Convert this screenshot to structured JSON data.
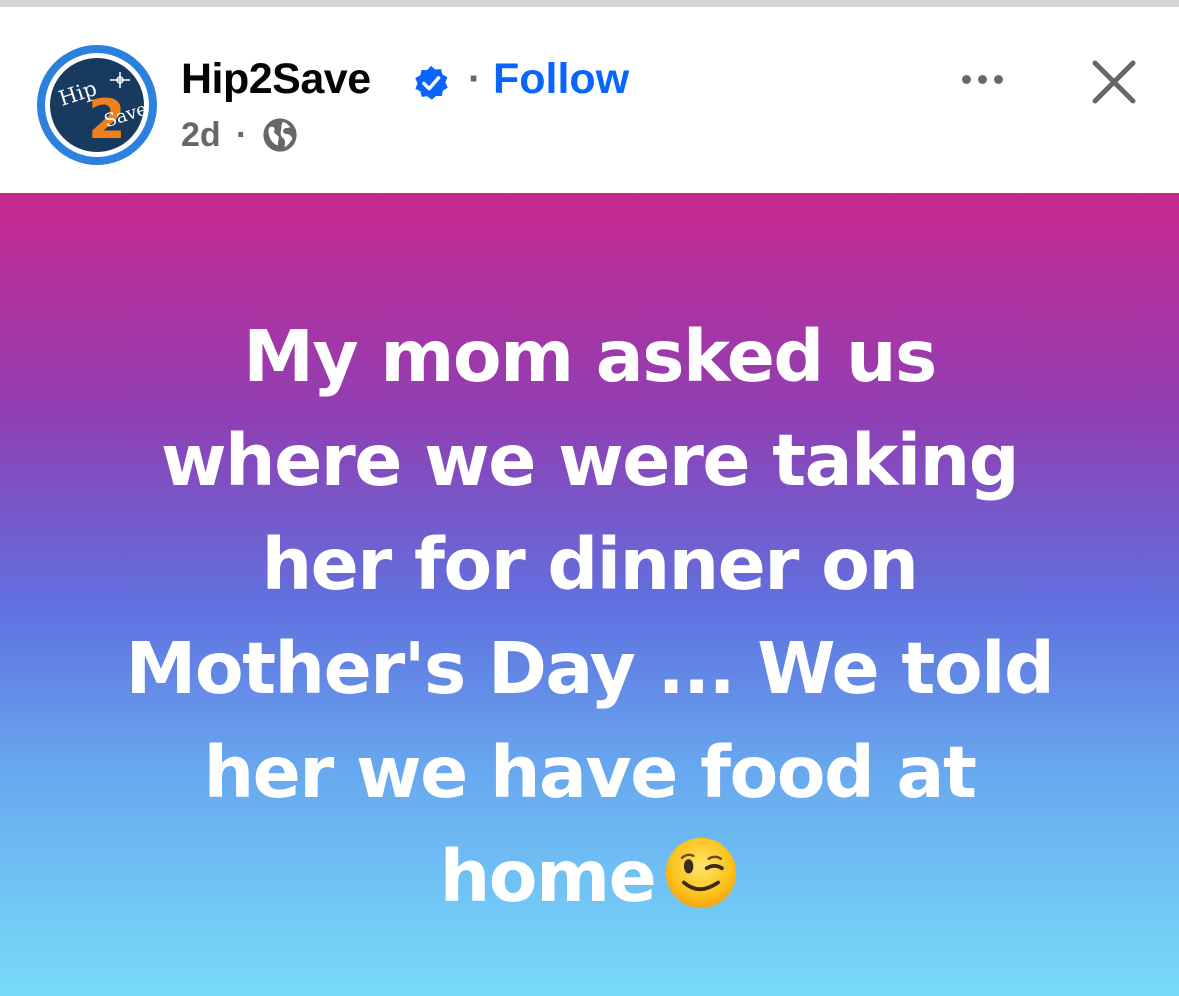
{
  "post": {
    "page_name": "Hip2Save",
    "follow_label": "Follow",
    "separator": "·",
    "timestamp": "2d",
    "privacy_icon": "globe-icon",
    "avatar_logo_text": "Hip 2 Save",
    "verified_icon": "verified-badge-icon",
    "more_icon": "more-options-icon",
    "close_icon": "close-icon",
    "text_lines": [
      "My mom asked us",
      "where we were taking",
      "her for dinner on",
      "Mother's Day ... We told",
      "her we have food at",
      "home"
    ],
    "emoji": "winking-face-emoji"
  },
  "colors": {
    "follow": "#0866ff",
    "name": "#050505",
    "meta": "#65676b",
    "gradient_top": "#c8288f",
    "gradient_mid": "#5f72e0",
    "gradient_bottom": "#77dcf9"
  }
}
